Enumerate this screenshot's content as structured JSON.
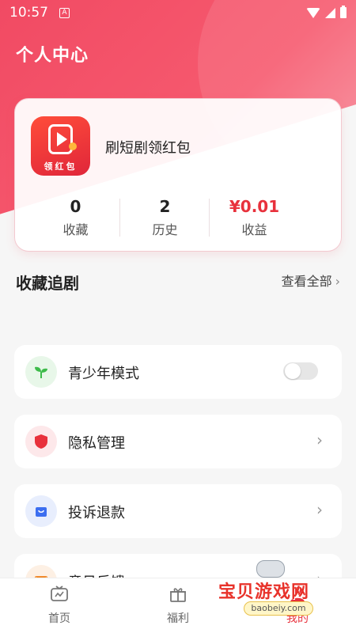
{
  "status_bar": {
    "time": "10:57",
    "notification_glyph": "A"
  },
  "header": {
    "title": "个人中心"
  },
  "profile": {
    "logo_text": "领红包",
    "app_name": "刷短剧领红包",
    "stats": [
      {
        "value": "0",
        "label": "收藏"
      },
      {
        "value": "2",
        "label": "历史"
      },
      {
        "value": "¥0.01",
        "label": "收益"
      }
    ]
  },
  "favorites": {
    "title": "收藏追剧",
    "view_all": "查看全部"
  },
  "menu": {
    "teen_mode": {
      "label": "青少年模式",
      "icon": "sprout-icon",
      "icon_color": "#3dbb4a",
      "icon_bg": "#e8f7e9",
      "toggle_on": false
    },
    "privacy": {
      "label": "隐私管理",
      "icon": "shield-icon",
      "icon_color": "#e8313c",
      "icon_bg": "#fde8ea"
    },
    "complaint": {
      "label": "投诉退款",
      "icon": "bag-icon",
      "icon_color": "#3c6ef0",
      "icon_bg": "#e8eefd"
    },
    "feedback": {
      "label": "意见反馈",
      "icon": "mail-icon",
      "icon_color": "#f08a2c",
      "icon_bg": "#fdf0e4"
    }
  },
  "bottom_nav": [
    {
      "label": "首页",
      "icon": "tv-icon"
    },
    {
      "label": "福利",
      "icon": "gift-icon"
    },
    {
      "label": "我的",
      "icon": "user-icon",
      "active": true
    }
  ],
  "watermark": {
    "text": "宝贝游戏网",
    "url": "baobeiy.com"
  },
  "colors": {
    "accent": "#e8313c",
    "header_gradient_start": "#f14a63"
  }
}
